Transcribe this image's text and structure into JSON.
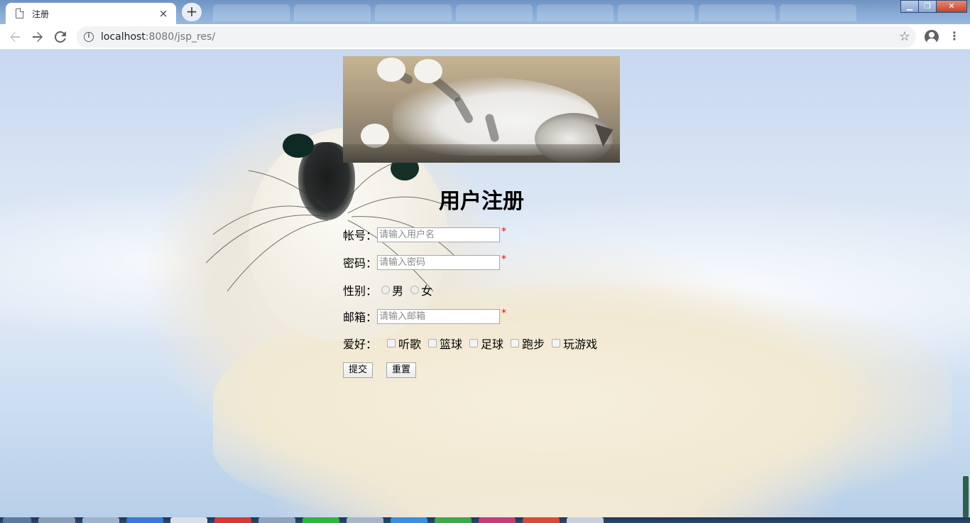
{
  "browser": {
    "tab_title": "注册",
    "tab_close": "×",
    "new_tab": "+",
    "url_host": "localhost",
    "url_rest": ":8080/jsp_res/",
    "window_controls": [
      "▁",
      "❐",
      "✕"
    ]
  },
  "form": {
    "heading": "用户注册",
    "username_label": "帐号：",
    "username_placeholder": "请输入用户名",
    "password_label": "密码：",
    "password_placeholder": "请输入密码",
    "gender_label": "性别：",
    "gender_options": [
      "男",
      "女"
    ],
    "email_label": "邮箱：",
    "email_placeholder": "请输入邮箱",
    "required_mark": "*",
    "hobby_label": "爱好：",
    "hobby_options": [
      "听歌",
      "篮球",
      "足球",
      "跑步",
      "玩游戏"
    ],
    "submit_label": "提交",
    "reset_label": "重置"
  },
  "colors": {
    "required": "#ff0000",
    "tab_bar": "#88aad6"
  },
  "icons": [
    "document-icon",
    "close-icon",
    "plus-icon",
    "back-icon",
    "forward-icon",
    "reload-icon",
    "info-icon",
    "star-icon",
    "profile-icon",
    "menu-icon"
  ]
}
